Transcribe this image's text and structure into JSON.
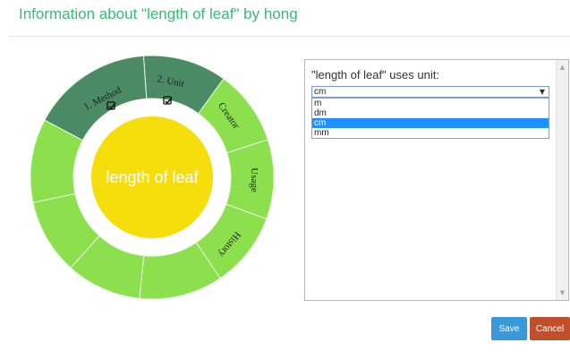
{
  "header": {
    "title": "Information about \"length of leaf\" by hong"
  },
  "wheel": {
    "center_label": "length of leaf",
    "segments": [
      {
        "label": "1. Method",
        "icon": "edit-icon"
      },
      {
        "label": "2. Unit",
        "icon": "edit-icon"
      },
      {
        "label": "Creator"
      },
      {
        "label": "Usage"
      },
      {
        "label": "History"
      }
    ],
    "colors": {
      "active_segment": "#4a8a64",
      "segment": "#8ce04e",
      "center": "#f5de0c"
    }
  },
  "unit_panel": {
    "label": "\"length of leaf\" uses unit:",
    "selected": "cm",
    "options": [
      "m",
      "dm",
      "cm",
      "mm"
    ]
  },
  "buttons": {
    "save": "Save",
    "cancel": "Cancel"
  }
}
